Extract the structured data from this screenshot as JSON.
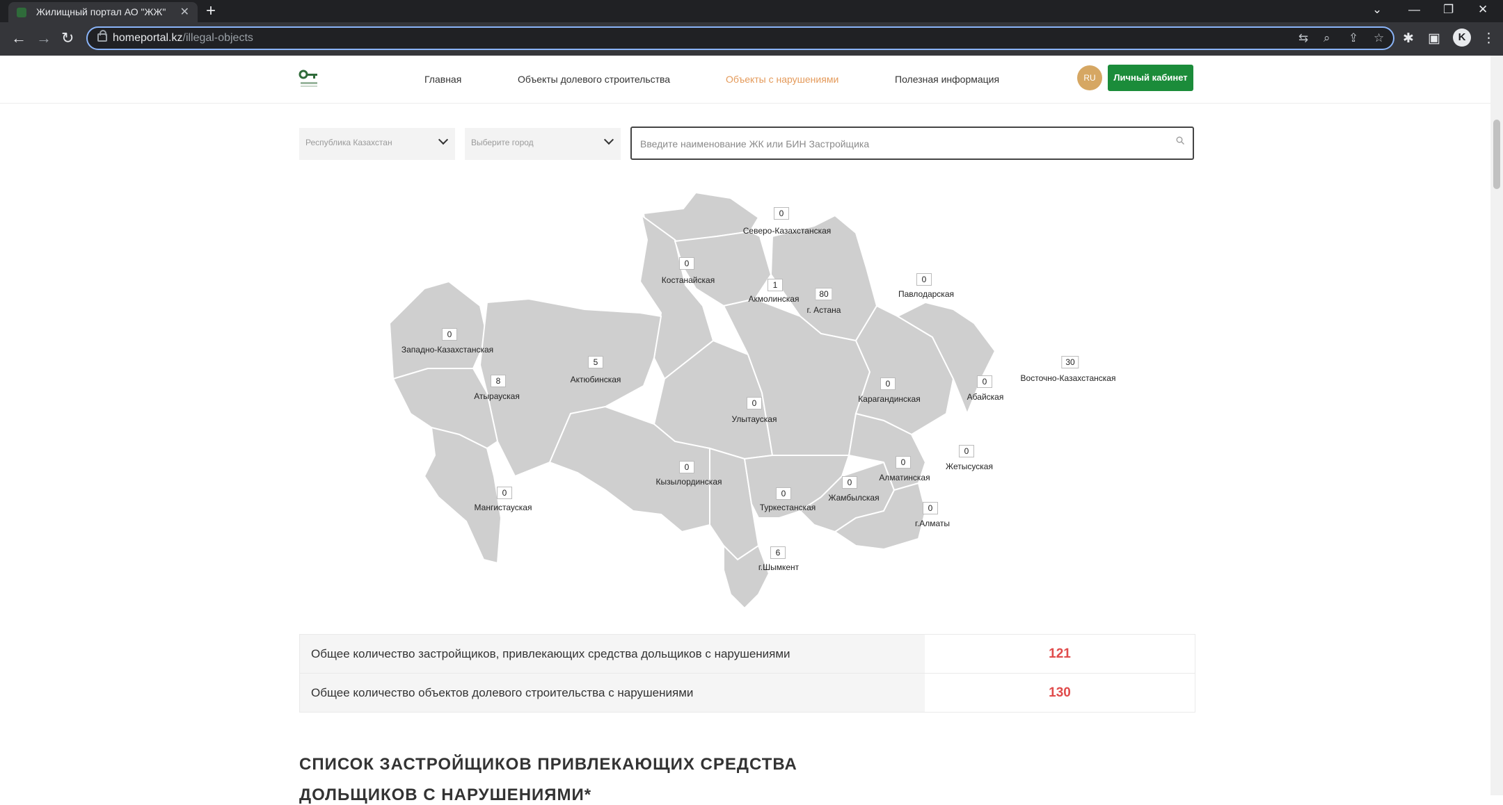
{
  "browser": {
    "tab_title": "Жилищный портал АО \"ЖЖ\"",
    "url_host": "homeportal.kz",
    "url_path": "/illegal-objects",
    "profile_letter": "K"
  },
  "header": {
    "nav": [
      "Главная",
      "Объекты долевого строительства",
      "Объекты с нарушениями",
      "Полезная информация"
    ],
    "lang": "RU",
    "cabinet_button": "Личный кабинет",
    "active_color": "#e49a5a",
    "brand_color": "#1b8c3a"
  },
  "filters": {
    "country": "Республика Казахстан",
    "city_placeholder": "Выберите город",
    "search_placeholder": "Введите наименование ЖК или БИН Застройщика"
  },
  "map": {
    "regions": [
      {
        "name": "Северо-Казахстанская",
        "count": "0"
      },
      {
        "name": "Костанайская",
        "count": "0"
      },
      {
        "name": "Акмолинская",
        "count": "1"
      },
      {
        "name": "г. Астана",
        "count": "80"
      },
      {
        "name": "Павлодарская",
        "count": "0"
      },
      {
        "name": "Западно-Казахстанская",
        "count": "0"
      },
      {
        "name": "Актюбинская",
        "count": "5"
      },
      {
        "name": "Атырауская",
        "count": "8"
      },
      {
        "name": "Улытауская",
        "count": "0"
      },
      {
        "name": "Карагандинская",
        "count": "0"
      },
      {
        "name": "Абайская",
        "count": "0"
      },
      {
        "name": "Восточно-Казахстанская",
        "count": "30"
      },
      {
        "name": "Мангистауская",
        "count": "0"
      },
      {
        "name": "Кызылординская",
        "count": "0"
      },
      {
        "name": "Туркестанская",
        "count": "0"
      },
      {
        "name": "Жамбылская",
        "count": "0"
      },
      {
        "name": "Алматинская",
        "count": "0"
      },
      {
        "name": "Жетысуская",
        "count": "0"
      },
      {
        "name": "г.Алматы",
        "count": "0"
      },
      {
        "name": "г.Шымкент",
        "count": "6"
      }
    ]
  },
  "stats": [
    {
      "label": "Общее количество застройщиков, привлекающих средства дольщиков с нарушениями",
      "value": "121"
    },
    {
      "label": "Общее количество объектов долевого строительства с нарушениями",
      "value": "130"
    }
  ],
  "section": {
    "title": "СПИСОК ЗАСТРОЙЩИКОВ ПРИВЛЕКАЮЩИХ СРЕДСТВА",
    "title_line2": "ДОЛЬЩИКОВ С НАРУШЕНИЯМИ*"
  }
}
